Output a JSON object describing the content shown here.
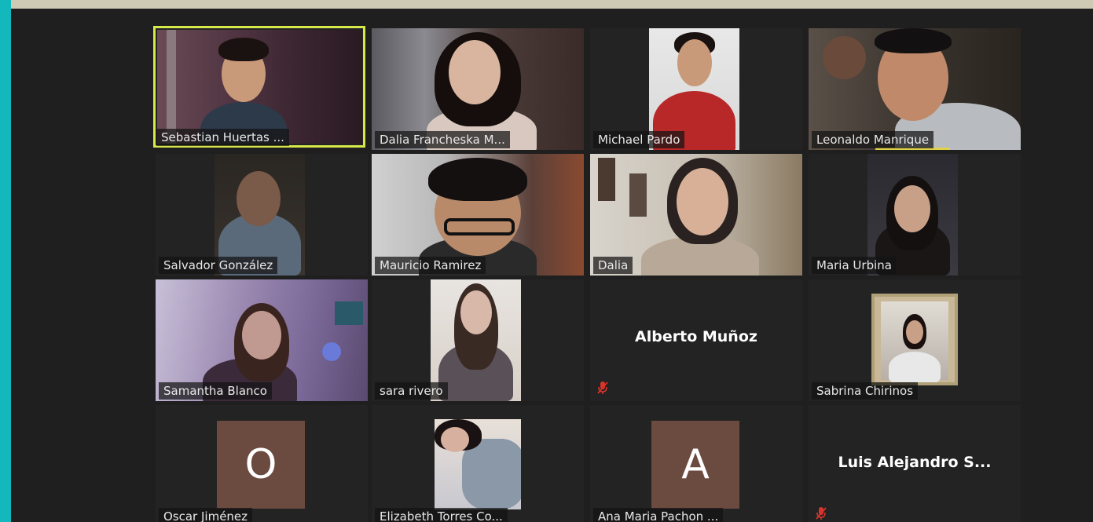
{
  "participants": [
    {
      "name": "Sebastian Huertas ..."
    },
    {
      "name": "Dalia Francheska M..."
    },
    {
      "name": "Michael Pardo"
    },
    {
      "name": "Leonaldo Manrique"
    },
    {
      "name": "Salvador González"
    },
    {
      "name": "Mauricio Ramirez"
    },
    {
      "name": "Dalia"
    },
    {
      "name": "Maria Urbina"
    },
    {
      "name": "Samantha Blanco"
    },
    {
      "name": "sara rivero"
    },
    {
      "name": "Alberto Muñoz"
    },
    {
      "name": "Sabrina Chirinos"
    },
    {
      "name": "Oscar Jiménez",
      "avatar_letter": "O"
    },
    {
      "name": "Elizabeth Torres Co..."
    },
    {
      "name": "Ana Maria Pachon ...",
      "avatar_letter": "A"
    },
    {
      "name": "Luis Alejandro S..."
    }
  ],
  "colors": {
    "active_speaker_border": "#d6e84a",
    "muted_icon": "#d9342b",
    "avatar_bg": "#6b4a3f",
    "accent_strip": "#13b8bc"
  }
}
